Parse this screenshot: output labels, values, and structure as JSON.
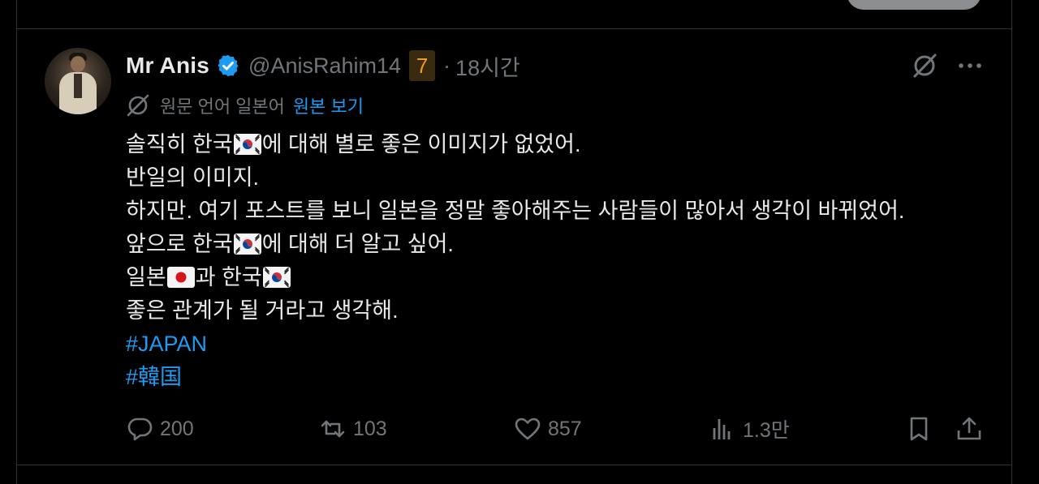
{
  "tweet": {
    "author_name": "Mr Anis",
    "handle": "@AnisRahim14",
    "badge": "7",
    "separator": "·",
    "time": "18시간",
    "translation": {
      "label": "원문 언어 일본어",
      "link": "원본 보기"
    },
    "lines": [
      [
        {
          "t": "text",
          "v": "솔직히 한국"
        },
        {
          "t": "flag",
          "v": "kr"
        },
        {
          "t": "text",
          "v": "에 대해 별로 좋은 이미지가 없었어."
        }
      ],
      [
        {
          "t": "text",
          "v": "반일의 이미지."
        }
      ],
      [
        {
          "t": "text",
          "v": "하지만. 여기 포스트를 보니 일본을 정말 좋아해주는 사람들이 많아서 생각이 바뀌었어."
        }
      ],
      [
        {
          "t": "text",
          "v": "앞으로 한국"
        },
        {
          "t": "flag",
          "v": "kr"
        },
        {
          "t": "text",
          "v": "에 대해 더 알고 싶어."
        }
      ],
      [
        {
          "t": "text",
          "v": "일본"
        },
        {
          "t": "flag",
          "v": "jp"
        },
        {
          "t": "text",
          "v": "과 한국"
        },
        {
          "t": "flag",
          "v": "kr"
        }
      ],
      [
        {
          "t": "text",
          "v": "좋은 관계가 될 거라고 생각해."
        }
      ],
      [
        {
          "t": "hashtag",
          "v": "#JAPAN"
        }
      ],
      [
        {
          "t": "hashtag",
          "v": "#韓国"
        }
      ]
    ],
    "stats": {
      "replies": "200",
      "reposts": "103",
      "likes": "857",
      "views": "1.3만"
    }
  },
  "icons": {
    "verified": "verified-badge-icon",
    "grok": "grok-icon",
    "more": "more-icon",
    "translate": "translate-icon",
    "reply": "reply-icon",
    "repost": "repost-icon",
    "like": "like-icon",
    "views": "views-icon",
    "bookmark": "bookmark-icon",
    "share": "share-icon"
  },
  "colors": {
    "background": "#000000",
    "text": "#e7e9ea",
    "muted": "#71767b",
    "accent": "#1d9bf0",
    "border": "#2f3336",
    "badge_text": "#f29b1d"
  }
}
